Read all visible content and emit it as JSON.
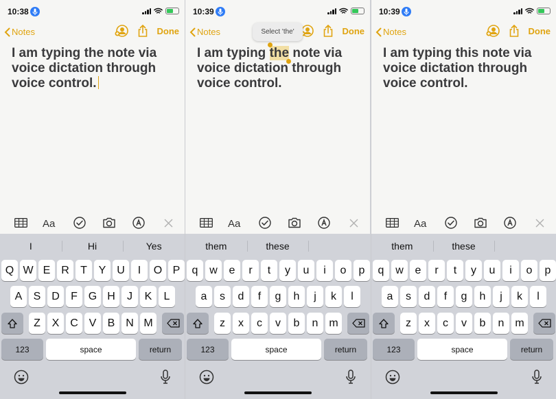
{
  "panels": [
    {
      "time": "10:38",
      "back_label": "Notes",
      "done_label": "Done",
      "note_text": "I am typing the note via voice dictation through voice control.",
      "suggestions": [
        "I",
        "Hi",
        "Yes"
      ],
      "row1": [
        "Q",
        "W",
        "E",
        "R",
        "T",
        "Y",
        "U",
        "I",
        "O",
        "P"
      ],
      "row2": [
        "A",
        "S",
        "D",
        "F",
        "G",
        "H",
        "J",
        "K",
        "L"
      ],
      "row3": [
        "Z",
        "X",
        "C",
        "V",
        "B",
        "N",
        "M"
      ],
      "key_123": "123",
      "key_space": "space",
      "key_return": "return"
    },
    {
      "time": "10:39",
      "back_label": "Notes",
      "done_label": "Done",
      "note_before": "I am typing ",
      "note_selected": "the",
      "note_after": " note via voice dictation through voice control.",
      "popup": "Select 'the'",
      "suggestions": [
        "them",
        "these",
        ""
      ],
      "row1": [
        "q",
        "w",
        "e",
        "r",
        "t",
        "y",
        "u",
        "i",
        "o",
        "p"
      ],
      "row2": [
        "a",
        "s",
        "d",
        "f",
        "g",
        "h",
        "j",
        "k",
        "l"
      ],
      "row3": [
        "z",
        "x",
        "c",
        "v",
        "b",
        "n",
        "m"
      ],
      "key_123": "123",
      "key_space": "space",
      "key_return": "return"
    },
    {
      "time": "10:39",
      "back_label": "Notes",
      "done_label": "Done",
      "note_text": "I am typing this note via voice dictation through voice control.",
      "suggestions": [
        "them",
        "these",
        ""
      ],
      "row1": [
        "q",
        "w",
        "e",
        "r",
        "t",
        "y",
        "u",
        "i",
        "o",
        "p"
      ],
      "row2": [
        "a",
        "s",
        "d",
        "f",
        "g",
        "h",
        "j",
        "k",
        "l"
      ],
      "row3": [
        "z",
        "x",
        "c",
        "v",
        "b",
        "n",
        "m"
      ],
      "key_123": "123",
      "key_space": "space",
      "key_return": "return"
    }
  ],
  "icons": [
    "dictation-mic-icon",
    "signal-icon",
    "wifi-icon",
    "battery-icon",
    "chevron-left-icon",
    "add-people-icon",
    "share-icon",
    "table-icon",
    "text-format-icon",
    "checklist-icon",
    "camera-icon",
    "markup-pen-icon",
    "close-icon",
    "shift-icon",
    "backspace-icon",
    "emoji-icon",
    "mic-icon"
  ],
  "colors": {
    "accent": "#e0a410",
    "mic_badge": "#2f7cf6",
    "battery": "#34c759",
    "selection": "#f2dfa4"
  }
}
